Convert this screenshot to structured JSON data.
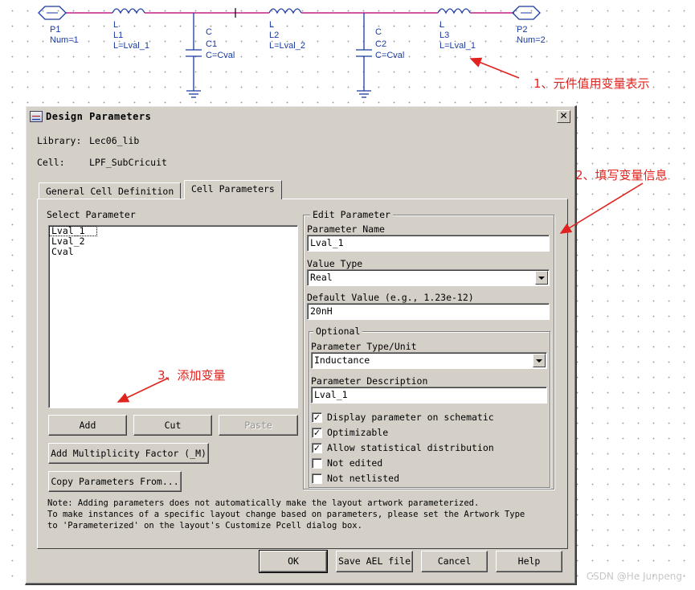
{
  "schematic": {
    "p1": {
      "name": "P1",
      "num": "Num=1"
    },
    "p2": {
      "name": "P2",
      "num": "Num=2"
    },
    "l1": {
      "type": "L",
      "name": "L1",
      "value": "L=Lval_1"
    },
    "l2": {
      "type": "L",
      "name": "L2",
      "value": "L=Lval_2"
    },
    "l3": {
      "type": "L",
      "name": "L3",
      "value": "L=Lval_1"
    },
    "c1": {
      "type": "C",
      "name": "C1",
      "value": "C=Cval"
    },
    "c2": {
      "type": "C",
      "name": "C2",
      "value": "C=Cval"
    },
    "wire_color": "#c0208a",
    "component_color": "#1a3aa0"
  },
  "annotations": {
    "a1": "1、元件值用变量表示",
    "a2": "2、填写变量信息",
    "a3": "3、添加变量",
    "color": "#e0231e"
  },
  "watermark": "CSDN @He Junpeng",
  "dialog": {
    "title": "Design Parameters",
    "close_label": "✕",
    "library_label": "Library:",
    "library_value": "Lec06_lib",
    "cell_label": "Cell:",
    "cell_value": "LPF_SubCricuit",
    "tabs": [
      "General Cell Definition",
      "Cell Parameters"
    ],
    "active_tab": "Cell Parameters",
    "select_parameter_label": "Select Parameter",
    "parameters": [
      "Lval_1",
      "Lval_2",
      "Cval"
    ],
    "buttons": {
      "add": "Add",
      "cut": "Cut",
      "paste": "Paste",
      "add_multiplicity": "Add Multiplicity Factor (_M)",
      "copy_params": "Copy Parameters From..."
    },
    "edit_parameter": {
      "group_label": "Edit Parameter",
      "name_label": "Parameter Name",
      "name_value": "Lval_1",
      "value_type_label": "Value Type",
      "value_type_value": "Real",
      "default_value_label": "Default Value (e.g., 1.23e-12)",
      "default_value_value": "20nH"
    },
    "optional": {
      "group_label": "Optional",
      "type_unit_label": "Parameter Type/Unit",
      "type_unit_value": "Inductance",
      "description_label": "Parameter Description",
      "description_value": "Lval_1"
    },
    "checkboxes": [
      {
        "label": "Display parameter on schematic",
        "checked": true
      },
      {
        "label": "Optimizable",
        "checked": true
      },
      {
        "label": "Allow statistical distribution",
        "checked": true
      },
      {
        "label": "Not edited",
        "checked": false
      },
      {
        "label": "Not netlisted",
        "checked": false
      }
    ],
    "note_lines": [
      "Note: Adding parameters does not automatically make the layout artwork parameterized.",
      "To make instances of a specific layout change based on parameters, please set the Artwork Type",
      "to 'Parameterized' on the layout's Customize Pcell dialog box."
    ],
    "footer": {
      "ok": "OK",
      "save_ael": "Save AEL file",
      "cancel": "Cancel",
      "help": "Help"
    }
  }
}
